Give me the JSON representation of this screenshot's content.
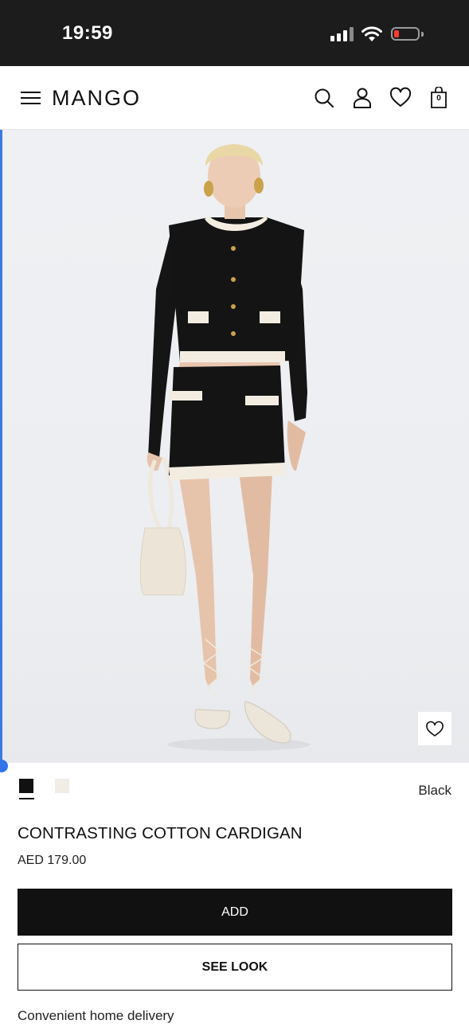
{
  "status_bar": {
    "time": "19:59"
  },
  "header": {
    "logo": "MANGO",
    "cart_count": "0"
  },
  "gallery": {
    "image_count": 5,
    "active_index": 1
  },
  "colors": {
    "options": [
      {
        "name": "Black",
        "hex": "#111111"
      },
      {
        "name": "Off-white",
        "hex": "#f1ede4"
      }
    ],
    "selected_label": "Black"
  },
  "product": {
    "title": "CONTRASTING COTTON CARDIGAN",
    "price": "AED 179.00"
  },
  "actions": {
    "add_label": "ADD",
    "see_look_label": "SEE LOOK"
  },
  "info": {
    "delivery": "Convenient home delivery"
  },
  "theme": {
    "accent": "#111111",
    "scroll_indicator": "#2f74e8",
    "battery_low": "#ff3b30"
  }
}
